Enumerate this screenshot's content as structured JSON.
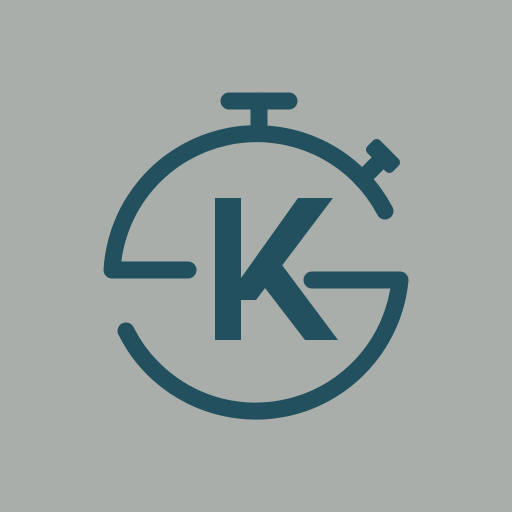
{
  "icon": {
    "name": "stopwatch-sk-logo",
    "logo_text": "SK",
    "colors": {
      "background": "#a9aeaa",
      "logo": "#22505f"
    }
  }
}
